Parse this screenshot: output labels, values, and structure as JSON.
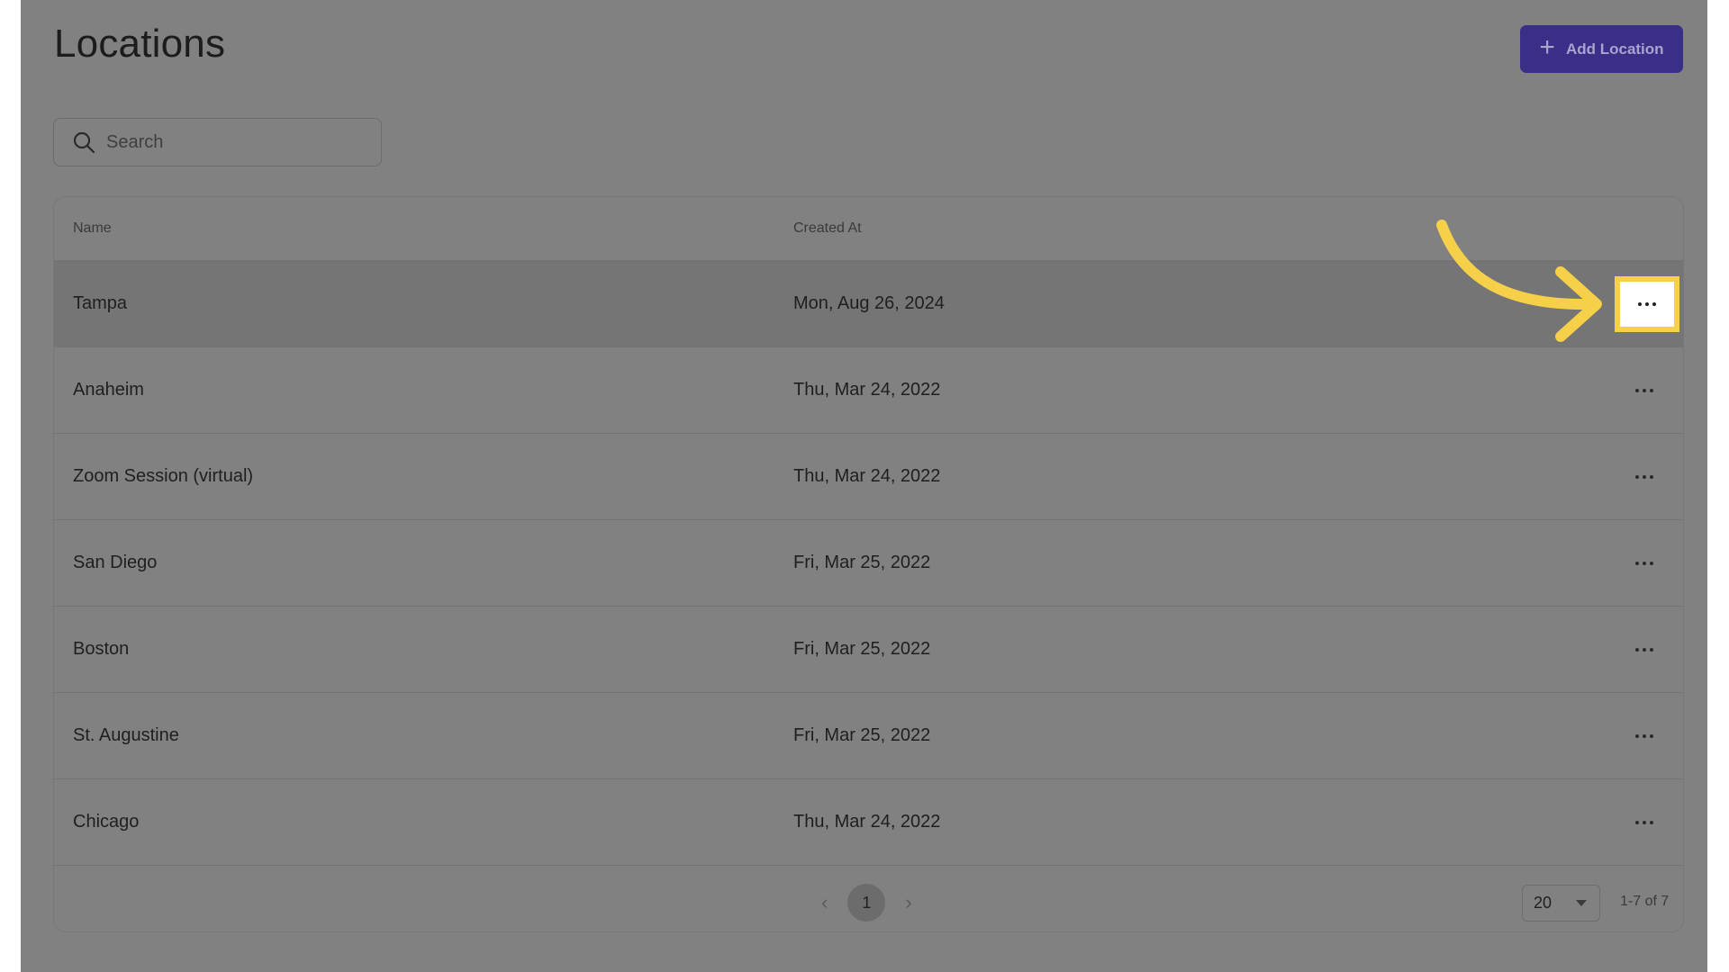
{
  "page": {
    "title": "Locations"
  },
  "toolbar": {
    "add_label": "Add Location",
    "add_icon": "plus-icon"
  },
  "search": {
    "placeholder": "Search",
    "value": "",
    "icon": "search-icon"
  },
  "table": {
    "headers": {
      "name": "Name",
      "created_at": "Created At"
    },
    "rows": [
      {
        "name": "Tampa",
        "created_at": "Mon, Aug 26, 2024",
        "highlighted": true
      },
      {
        "name": "Anaheim",
        "created_at": "Thu, Mar 24, 2022"
      },
      {
        "name": "Zoom Session (virtual)",
        "created_at": "Thu, Mar 24, 2022"
      },
      {
        "name": "San Diego",
        "created_at": "Fri, Mar 25, 2022"
      },
      {
        "name": "Boston",
        "created_at": "Fri, Mar 25, 2022"
      },
      {
        "name": "St. Augustine",
        "created_at": "Fri, Mar 25, 2022"
      },
      {
        "name": "Chicago",
        "created_at": "Thu, Mar 24, 2022"
      }
    ],
    "row_action_icon": "more-horizontal-icon"
  },
  "pagination": {
    "current_page": "1",
    "per_page": "20",
    "range_text": "1-7 of 7"
  },
  "colors": {
    "overlay": "#818181",
    "accent": "#3a2f86",
    "highlight": "#f5d048"
  }
}
